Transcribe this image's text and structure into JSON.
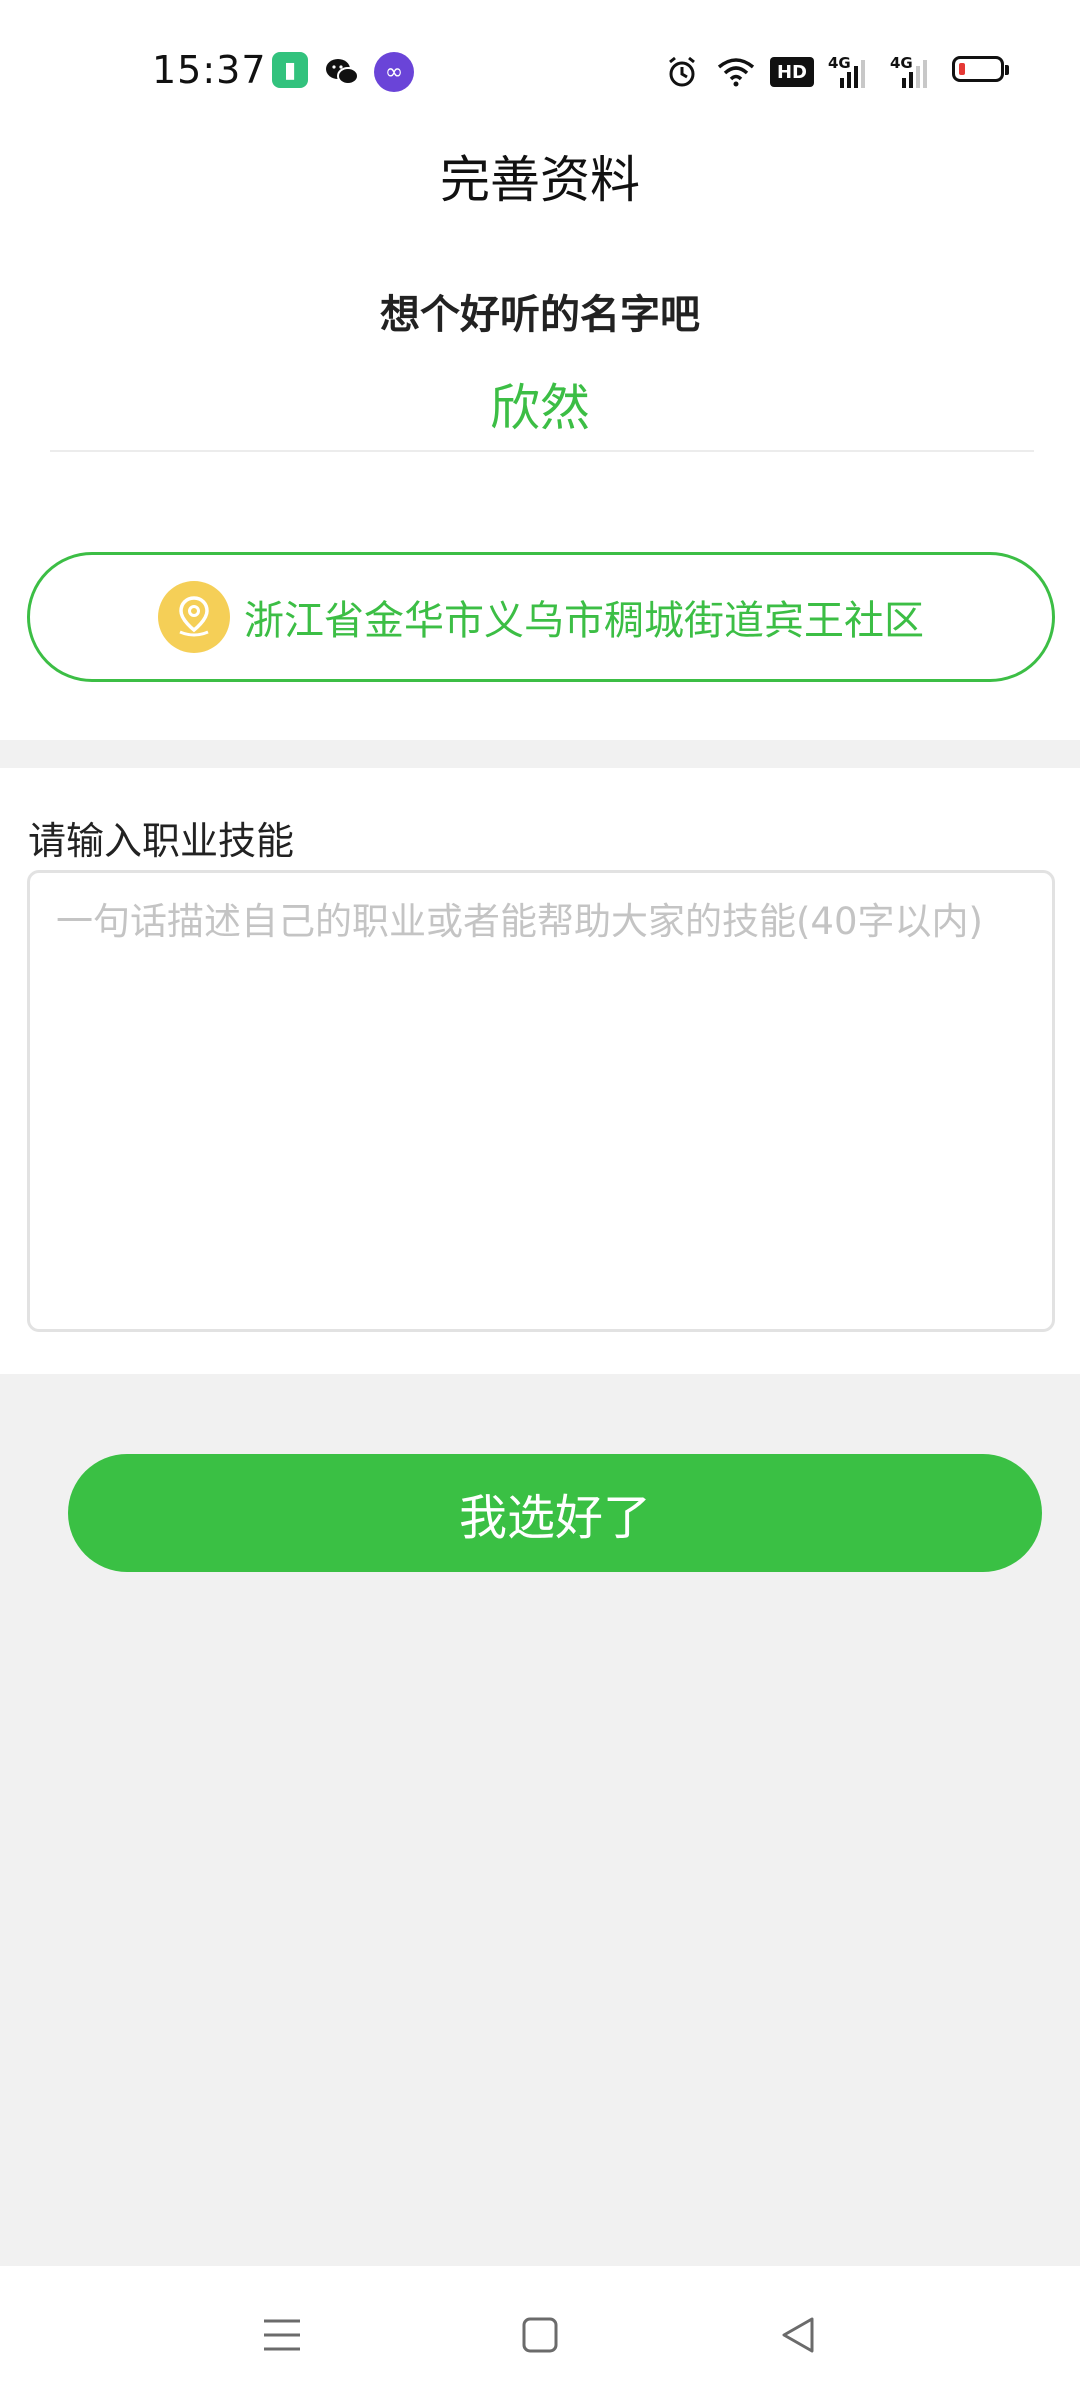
{
  "status_bar": {
    "time": "15:37",
    "hd_badge": "HD",
    "signal1_label": "4G",
    "signal2_label": "4G",
    "icons": [
      "battery-app-icon",
      "wechat-icon",
      "loop-app-icon",
      "alarm-icon",
      "wifi-icon",
      "hd-icon",
      "signal-icon",
      "signal-icon",
      "battery-icon"
    ]
  },
  "header": {
    "title": "完善资料"
  },
  "name_section": {
    "prompt": "想个好听的名字吧",
    "value": "欣然"
  },
  "location": {
    "text": "浙江省金华市义乌市稠城街道宾王社区",
    "icon": "location-pin-icon"
  },
  "skill": {
    "label": "请输入职业技能",
    "placeholder": "一句话描述自己的职业或者能帮助大家的技能(40字以内)",
    "value": ""
  },
  "confirm_button": {
    "label": "我选好了"
  },
  "nav_bar": {
    "items": [
      "menu-icon",
      "home-icon",
      "back-icon"
    ]
  },
  "colors": {
    "accent": "#3cbe45",
    "button": "#3ac044",
    "location_icon_bg": "#f5cf57",
    "background": "#f1f1f1",
    "battery_low": "#e53935"
  }
}
